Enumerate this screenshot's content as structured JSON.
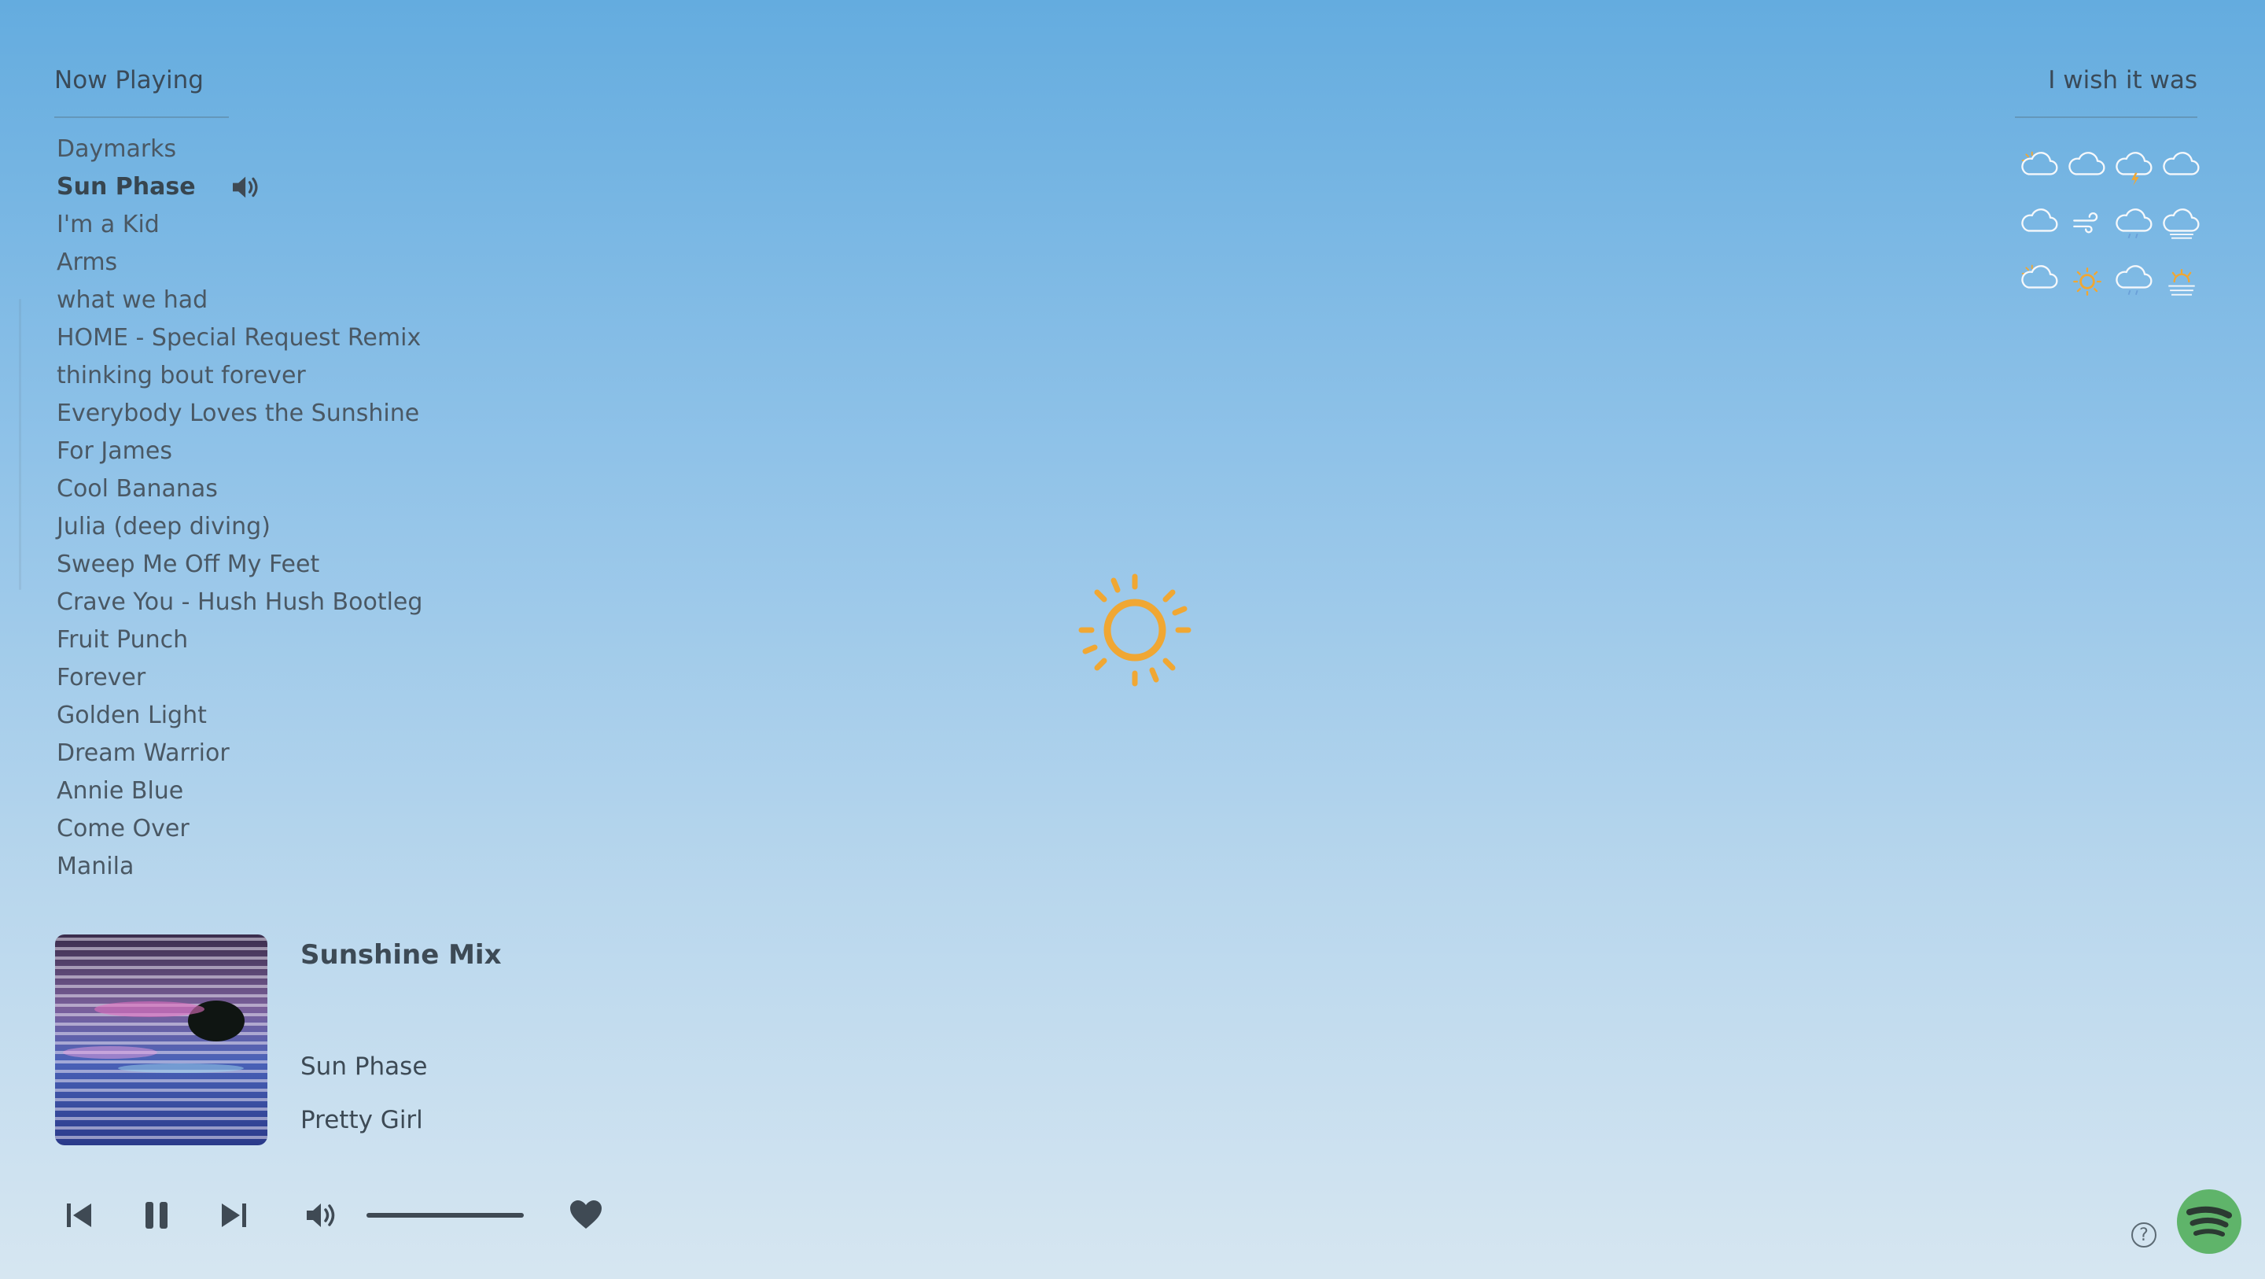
{
  "header": {
    "left_title": "Now Playing",
    "right_title": "I wish it was"
  },
  "playlist": [
    "Daymarks",
    "Sun Phase",
    "I'm a Kid",
    "Arms",
    "what we had",
    "HOME - Special Request Remix",
    "thinking bout forever",
    "Everybody Loves the Sunshine",
    "For James",
    "Cool Bananas",
    "Julia (deep diving)",
    "Sweep Me Off My Feet",
    "Crave You - Hush Hush Bootleg",
    "Fruit Punch",
    "Forever",
    "Golden Light",
    "Dream Warrior",
    "Annie Blue",
    "Come Over",
    "Manila"
  ],
  "current_track_index": 1,
  "current_track_indicator_icon": "speaker-icon",
  "weather_icons": [
    "partly-cloudy-icon",
    "cloud-icon",
    "thunder-cloud-icon",
    "cloud-icon",
    "cloud-icon",
    "wind-icon",
    "rain-cloud-icon",
    "fog-cloud-icon",
    "partly-cloudy-icon",
    "sun-icon",
    "rain-cloud-icon",
    "sun-haze-icon"
  ],
  "current_weather_icon": "sun-icon",
  "now_playing": {
    "playlist_name": "Sunshine Mix",
    "track": "Sun Phase",
    "artist": "Pretty Girl"
  },
  "player": {
    "volume_level": 1.0,
    "liked": true
  },
  "colors": {
    "sun": "#f0a733",
    "spotify_green": "#5fb46a",
    "text": "#3d4a55"
  }
}
